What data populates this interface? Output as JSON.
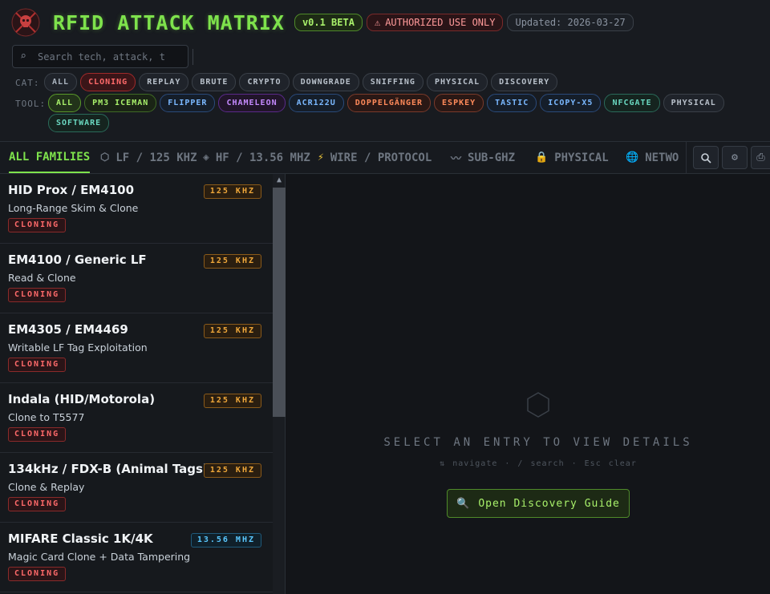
{
  "app": {
    "title": "RFID ATTACK MATRIX",
    "version": "v0.1 BETA",
    "warning": "AUTHORIZED USE ONLY",
    "updated": "Updated: 2026-03-27"
  },
  "search": {
    "placeholder": "Search tech, attack, t"
  },
  "filters": {
    "cat_label": "CAT:",
    "tool_label": "TOOL:",
    "categories": [
      {
        "label": "ALL",
        "color": "#aab4bf",
        "border": "#3a4048",
        "bg": "#1f232a"
      },
      {
        "label": "CLONING",
        "color": "#ff6a6a",
        "border": "#a02a2a",
        "bg": "#3a1518"
      },
      {
        "label": "REPLAY",
        "color": "#b8c0ca",
        "border": "#3a4048",
        "bg": "#1f232a"
      },
      {
        "label": "BRUTE",
        "color": "#b8c0ca",
        "border": "#3a4048",
        "bg": "#1f232a"
      },
      {
        "label": "CRYPTO",
        "color": "#b8c0ca",
        "border": "#3a4048",
        "bg": "#1f232a"
      },
      {
        "label": "DOWNGRADE",
        "color": "#b8c0ca",
        "border": "#3a4048",
        "bg": "#1f232a"
      },
      {
        "label": "SNIFFING",
        "color": "#b8c0ca",
        "border": "#3a4048",
        "bg": "#1f232a"
      },
      {
        "label": "PHYSICAL",
        "color": "#b8c0ca",
        "border": "#3a4048",
        "bg": "#1f232a"
      },
      {
        "label": "DISCOVERY",
        "color": "#b8c0ca",
        "border": "#3a4048",
        "bg": "#1f232a"
      }
    ],
    "tools": [
      {
        "label": "ALL",
        "color": "#a8f06a",
        "border": "#5a9a2a",
        "bg": "#22331a"
      },
      {
        "label": "PM3 ICEMAN",
        "color": "#a8f06a",
        "border": "#3f6a25",
        "bg": "#1a2415"
      },
      {
        "label": "FLIPPER",
        "color": "#7ab8ff",
        "border": "#2a4a7a",
        "bg": "#151e2a"
      },
      {
        "label": "CHAMELEON",
        "color": "#c58aff",
        "border": "#5a2a8a",
        "bg": "#21152a"
      },
      {
        "label": "ACR122U",
        "color": "#7ab8ff",
        "border": "#2a4a7a",
        "bg": "#151e2a"
      },
      {
        "label": "DOPPELGÄNGER",
        "color": "#ff8a5a",
        "border": "#7a3a2a",
        "bg": "#2a1815"
      },
      {
        "label": "ESPKEY",
        "color": "#ff8a5a",
        "border": "#7a3a2a",
        "bg": "#2a1815"
      },
      {
        "label": "TASTIC",
        "color": "#7ab8ff",
        "border": "#2a4a7a",
        "bg": "#151e2a"
      },
      {
        "label": "ICOPY-X5",
        "color": "#7ab8ff",
        "border": "#2a4a7a",
        "bg": "#151e2a"
      },
      {
        "label": "NFCGATE",
        "color": "#6ad8c0",
        "border": "#2a6a5a",
        "bg": "#15241f"
      },
      {
        "label": "PHYSICAL",
        "color": "#b8c0ca",
        "border": "#3a4048",
        "bg": "#1f232a"
      },
      {
        "label": "SOFTWARE",
        "color": "#6ad8c0",
        "border": "#2a6a5a",
        "bg": "#15241f"
      }
    ]
  },
  "tabs": [
    {
      "label": "ALL FAMILIES",
      "icon": ""
    },
    {
      "label": "LF / 125 KHZ",
      "icon": "⬡"
    },
    {
      "label": "HF / 13.56 MHZ",
      "icon": "◈"
    },
    {
      "label": "WIRE / PROTOCOL",
      "icon": "⚡"
    },
    {
      "label": "SUB-GHZ",
      "icon": "〰"
    },
    {
      "label": "PHYSICAL",
      "icon": "🔒"
    },
    {
      "label": "NETWO",
      "icon": "🌐"
    }
  ],
  "toolbar": {
    "search_icon": "search-icon",
    "settings_icon": "gear-icon",
    "export_icon": "export-icon"
  },
  "entries": [
    {
      "title": "HID Prox / EM4100",
      "subtitle": "Long-Range Skim & Clone",
      "tag": "CLONING",
      "freq": "125 KHZ",
      "band": "lf"
    },
    {
      "title": "EM4100 / Generic LF",
      "subtitle": "Read & Clone",
      "tag": "CLONING",
      "freq": "125 KHZ",
      "band": "lf"
    },
    {
      "title": "EM4305 / EM4469",
      "subtitle": "Writable LF Tag Exploitation",
      "tag": "CLONING",
      "freq": "125 KHZ",
      "band": "lf"
    },
    {
      "title": "Indala (HID/Motorola)",
      "subtitle": "Clone to T5577",
      "tag": "CLONING",
      "freq": "125 KHZ",
      "band": "lf"
    },
    {
      "title": "134kHz / FDX-B (Animal Tags)",
      "subtitle": "Clone & Replay",
      "tag": "CLONING",
      "freq": "125 KHZ",
      "band": "lf"
    },
    {
      "title": "MIFARE Classic 1K/4K",
      "subtitle": "Magic Card Clone + Data Tampering",
      "tag": "CLONING",
      "freq": "13.56 MHZ",
      "band": "hf"
    }
  ],
  "detail": {
    "empty_title": "SELECT AN ENTRY TO VIEW DETAILS",
    "hint": "⇅ navigate · / search · Esc clear",
    "guide_button": "Open Discovery Guide"
  },
  "colors": {
    "accent": "#7ee24c",
    "danger": "#ff6a6a",
    "lf": "#f0a83a",
    "hf": "#5ac8ff"
  }
}
